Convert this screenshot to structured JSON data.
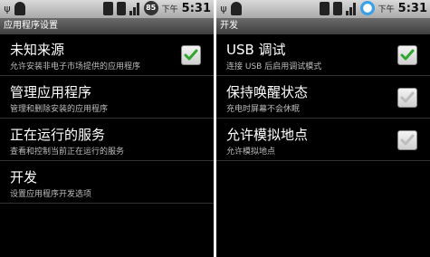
{
  "left_screen": {
    "status": {
      "battery": "85",
      "ampm": "下午",
      "time": "5:31"
    },
    "title": "应用程序设置",
    "items": [
      {
        "title": "未知来源",
        "summary": "允许安装非电子市场提供的应用程序",
        "checked": true
      },
      {
        "title": "管理应用程序",
        "summary": "管理和删除安装的应用程序"
      },
      {
        "title": "正在运行的服务",
        "summary": "查看和控制当前正在运行的服务"
      },
      {
        "title": "开发",
        "summary": "设置应用程序开发选项"
      }
    ]
  },
  "right_screen": {
    "status": {
      "ampm": "下午",
      "time": "5:31"
    },
    "title": "开发",
    "items": [
      {
        "title": "USB 调试",
        "summary": "连接 USB 后启用调试模式",
        "checked": true
      },
      {
        "title": "保持唤醒状态",
        "summary": "充电时屏幕不会休眠",
        "checked": false
      },
      {
        "title": "允许模拟地点",
        "summary": "允许模拟地点",
        "checked": false
      }
    ]
  },
  "colors": {
    "check_green": "#2fa82f",
    "check_gray": "#bdbdbd"
  }
}
